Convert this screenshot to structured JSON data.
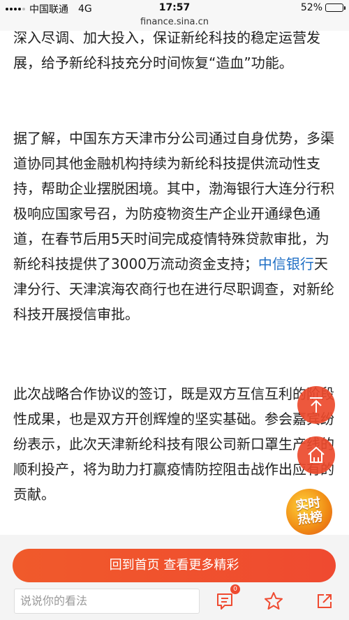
{
  "status_bar": {
    "carrier": "中国联通",
    "network": "4G",
    "time": "17:57",
    "battery": "52%",
    "battery_level": 0.52
  },
  "url": "finance.sina.cn",
  "article": {
    "paragraph_0": "深入尽调、加大投入，保证新纶科技的稳定运营发展，给予新纶科技充分时间恢复“造血”功能。",
    "paragraph_1_before_link": "据了解，中国东方天津市分公司通过自身优势，多渠道协同其他金融机构持续为新纶科技提供流动性支持，帮助企业摆脱困境。其中，渤海银行大连分行积极响应国家号召，为防疫物资生产企业开通绿色通道，在春节后用5天时间完成疫情特殊贷款审批，为新纶科技提供了3000万流动资金支持；",
    "paragraph_1_link": "中信银行",
    "paragraph_1_after_link": "天津分行、天津滨海农商行也在进行尽职调查，对新纶科技开展授信审批。",
    "paragraph_2": "此次战略合作协议的签订，既是双方互信互利的阶段性成果，也是双方开创辉煌的坚实基础。参会嘉宾纷纷表示，此次天津新纶科技有限公司新口罩生产线的顺利投产，将为助力打赢疫情防控阻击战作出应有的贡献。"
  },
  "floating": {
    "hot_badge_line1": "实时",
    "hot_badge_line2": "热榜"
  },
  "bottom": {
    "home_button": "回到首页 查看更多精彩",
    "comment_placeholder": "说说你的看法",
    "comment_count": "0"
  },
  "colors": {
    "accent": "#ef4a30",
    "link": "#1f6fc5"
  },
  "icons": [
    "signal-icon",
    "battery-icon",
    "arrow-up-icon",
    "home-icon",
    "comment-icon",
    "star-icon",
    "share-icon"
  ]
}
